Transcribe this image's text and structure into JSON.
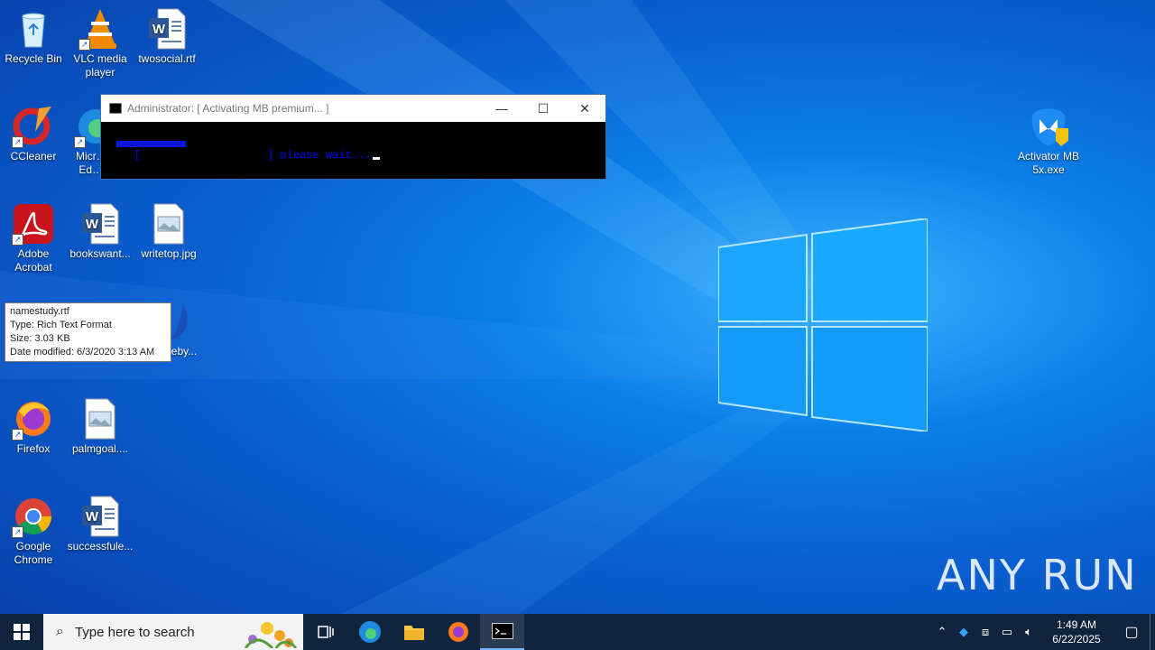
{
  "desktop": {
    "icons": [
      {
        "label": "Recycle Bin",
        "icon": "recycle-bin-icon"
      },
      {
        "label": "VLC media player",
        "icon": "vlc-icon"
      },
      {
        "label": "twosocial.rtf",
        "icon": "word-doc-icon"
      },
      {
        "label": "CCleaner",
        "icon": "ccleaner-icon"
      },
      {
        "label": "Micr… Ed…",
        "icon": "edge-icon"
      },
      {
        "label": "Adobe Acrobat",
        "icon": "acrobat-icon"
      },
      {
        "label": "bookswant...",
        "icon": "word-doc-icon"
      },
      {
        "label": "writetop.jpg",
        "icon": "image-file-icon"
      },
      {
        "label": "...eby...",
        "icon": "thunderbird-icon"
      },
      {
        "label": "Firefox",
        "icon": "firefox-icon"
      },
      {
        "label": "palmgoal....",
        "icon": "image-file-icon"
      },
      {
        "label": "Google Chrome",
        "icon": "chrome-icon"
      },
      {
        "label": "successfule...",
        "icon": "word-doc-icon"
      },
      {
        "label": "Activator MB 5x.exe",
        "icon": "malwarebytes-icon"
      }
    ]
  },
  "tooltip": {
    "line1": "namestudy.rtf",
    "line2": "Type: Rich Text Format",
    "line3": "Size: 3.03 KB",
    "line4": "Date modified: 6/3/2020 3:13 AM"
  },
  "cmd": {
    "title": "Administrator:  [ Activating MB premium... ]",
    "open_bracket": "[",
    "status_text": "] please wait...",
    "progress": 0.55,
    "minimize": "—",
    "maximize": "☐",
    "close": "✕"
  },
  "watermark": "ANY RUN",
  "taskbar": {
    "search_placeholder": "Type here to search",
    "time": "1:49 AM",
    "date": "6/22/2025"
  },
  "colors": {
    "desktop": "#0a5fd0",
    "taskbar": "#10243d",
    "cmd_text": "#0000ff"
  }
}
